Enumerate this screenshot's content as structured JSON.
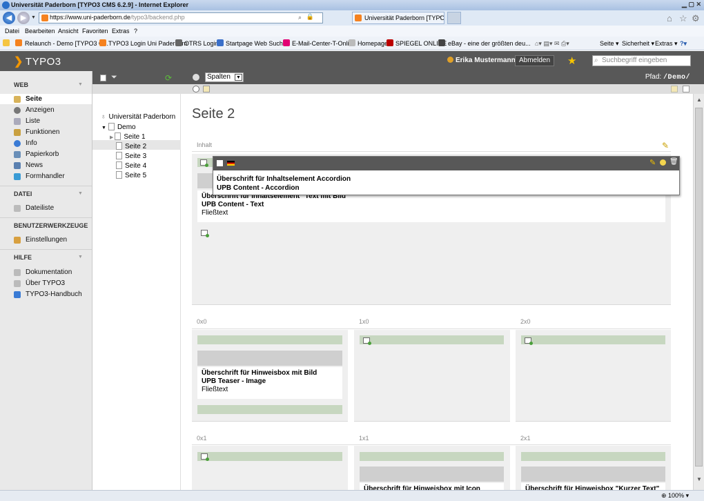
{
  "browser": {
    "window_title": "Universität Paderborn [TYPO3 CMS 6.2.9] - Internet Explorer",
    "url_host": "https://www.uni-paderborn.de",
    "url_path": "/typo3/backend.php",
    "tab_title": "Universität Paderborn [TYPO...",
    "menu": [
      "Datei",
      "Bearbeiten",
      "Ansicht",
      "Favoriten",
      "Extras",
      "?"
    ],
    "favorites": [
      "Relaunch - Demo [TYPO3 C...",
      "TYPO3 Login Uni Paderborn",
      "OTRS  Login",
      "Startpage Web Suchen",
      "E-Mail-Center-T-Online",
      "Homepage",
      "SPIEGEL ONLINE",
      "eBay - eine der größten deu..."
    ],
    "command_bar": [
      "Seite",
      "Sicherheit",
      "Extras"
    ],
    "zoom": "100%"
  },
  "typo3": {
    "logo": "TYPO3",
    "user": "Erika Mustermann",
    "logout_label": "Abmelden",
    "search_placeholder": "Suchbegriff eingeben"
  },
  "modules": {
    "web_label": "WEB",
    "web_items": [
      "Seite",
      "Anzeigen",
      "Liste",
      "Funktionen",
      "Info",
      "Papierkorb",
      "News",
      "Formhandler"
    ],
    "datei_label": "DATEI",
    "datei_items": [
      "Dateiliste"
    ],
    "benutzer_label": "BENUTZERWERKZEUGE",
    "benutzer_items": [
      "Einstellungen"
    ],
    "hilfe_label": "HILFE",
    "hilfe_items": [
      "Dokumentation",
      "Über TYPO3",
      "TYPO3-Handbuch"
    ]
  },
  "docheader": {
    "view_select": "Spalten",
    "path_label": "Pfad:",
    "path_value": "/Demo/"
  },
  "tree": {
    "root": "Universität Paderborn",
    "demo": "Demo",
    "pages": [
      "Seite 1",
      "Seite 2",
      "Seite 3",
      "Seite 4",
      "Seite 5"
    ]
  },
  "content": {
    "page_title": "Seite 2",
    "inhalt_label": "Inhalt",
    "popup_line1": "Überschrift für Inhaltselement Accordion",
    "popup_line2": "UPB Content - Accordion",
    "el1_line1": "Überschrift für Inhaltselement \"Text mit Bild\"",
    "el1_line2": "UPB Content - Text",
    "el1_line3": "Fließtext",
    "grid_labels": [
      "0x0",
      "1x0",
      "2x0",
      "0x1",
      "1x1",
      "2x1"
    ],
    "teaser_line1": "Überschrift für Hinweisbox mit Bild",
    "teaser_line2": "UPB Teaser - Image",
    "teaser_line3": "Fließtext",
    "cut_1x1": "Überschrift für Hinweisbox mit Icon",
    "cut_2x1": "Überschrift für Hinweisbox \"Kurzer Text\""
  }
}
